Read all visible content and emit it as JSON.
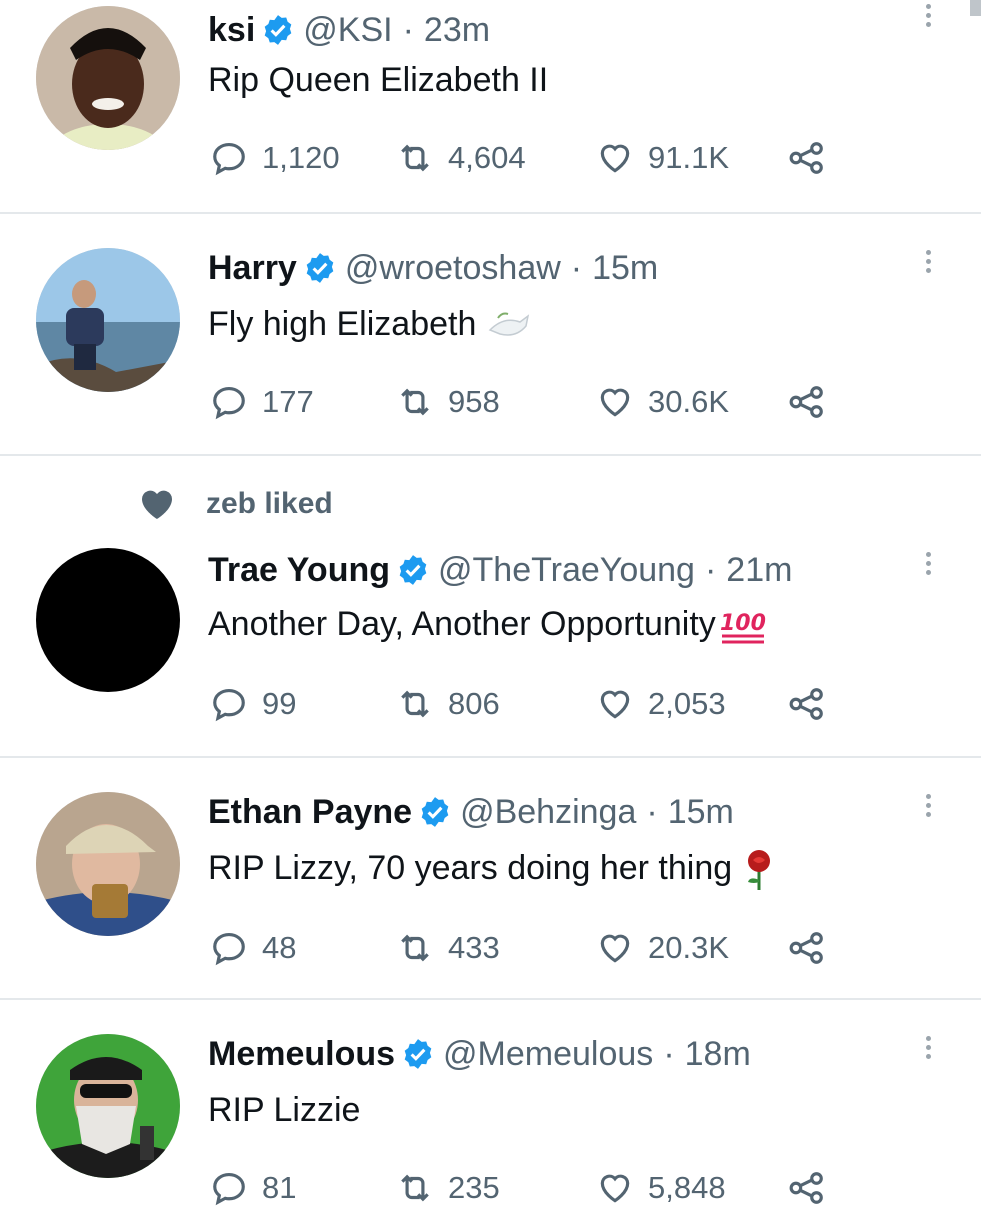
{
  "tweets": [
    {
      "name": "ksi",
      "handle": "@KSI",
      "time": "23m",
      "text": "Rip Queen Elizabeth II",
      "replies": "1,120",
      "retweets": "4,604",
      "likes": "91.1K",
      "emoji": ""
    },
    {
      "name": "Harry",
      "handle": "@wroetoshaw",
      "time": "15m",
      "text": "Fly high Elizabeth",
      "replies": "177",
      "retweets": "958",
      "likes": "30.6K",
      "emoji": "dove-emoji"
    },
    {
      "name": "Trae Young",
      "handle": "@TheTraeYoung",
      "time": "21m",
      "text": "Another Day, Another Opportunity",
      "replies": "99",
      "retweets": "806",
      "likes": "2,053",
      "emoji": "hundred-points-emoji"
    },
    {
      "name": "Ethan Payne",
      "handle": "@Behzinga",
      "time": "15m",
      "text": "RIP Lizzy, 70 years doing her thing",
      "replies": "48",
      "retweets": "433",
      "likes": "20.3K",
      "emoji": "rose-emoji"
    },
    {
      "name": "Memeulous",
      "handle": "@Memeulous",
      "time": "18m",
      "text": "RIP Lizzie",
      "replies": "81",
      "retweets": "235",
      "likes": "5,848",
      "emoji": ""
    }
  ],
  "social_context": {
    "text": "zeb liked",
    "icon": "heart-filled-icon"
  },
  "separator": "·",
  "colors": {
    "text": "#0f1419",
    "muted": "#536471",
    "verified": "#1d9bf0",
    "divider": "#e4e8eb"
  }
}
